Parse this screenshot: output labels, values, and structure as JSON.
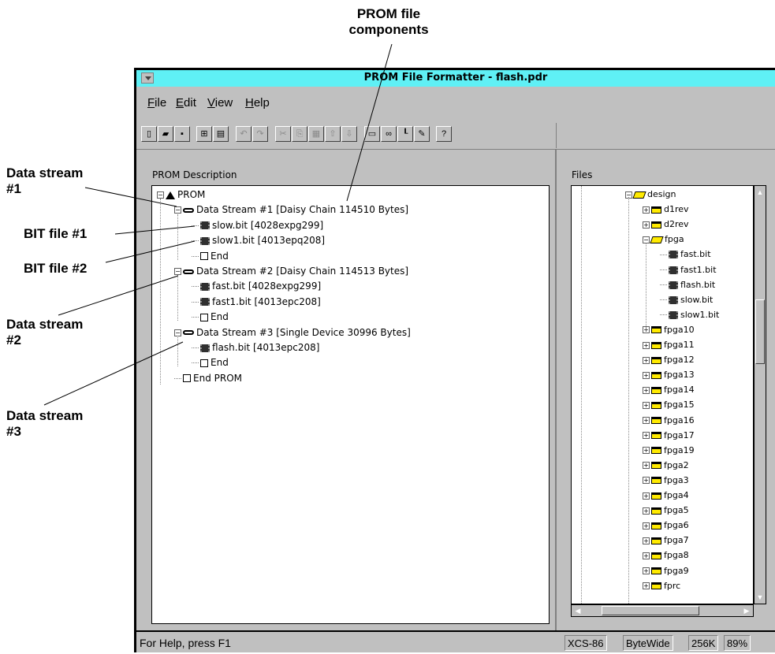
{
  "annotations": {
    "prom_components": [
      "PROM file",
      "components"
    ],
    "data_stream_1": [
      "Data stream",
      "#1"
    ],
    "bit_file_1": "BIT file #1",
    "bit_file_2": "BIT file #2",
    "data_stream_2": [
      "Data stream",
      "#2"
    ],
    "data_stream_3": [
      "Data stream",
      "#3"
    ]
  },
  "window": {
    "title": "PROM File Formatter - flash.pdr",
    "menu": [
      "File",
      "Edit",
      "View",
      "Help"
    ],
    "menu_mnemonics": [
      "F",
      "E",
      "V",
      "H"
    ]
  },
  "toolbar": {
    "buttons": [
      "new-icon",
      "open-icon",
      "save-icon",
      "copy-format-icon",
      "properties-icon",
      "undo-icon",
      "redo-icon",
      "cut-icon",
      "copy-icon",
      "paste-icon",
      "move-up-icon",
      "move-down-icon",
      "add-prom-icon",
      "add-stream-icon",
      "tree-icon",
      "wand-icon",
      "context-help-icon"
    ],
    "glyphs": [
      "▯",
      "▰",
      "▪",
      "⊞",
      "▤",
      "↶",
      "↷",
      "✂",
      "⎘",
      "▦",
      "⇧",
      "⇩",
      "▭",
      "∞",
      "┖",
      "✎",
      "?"
    ],
    "disabled": [
      false,
      false,
      false,
      false,
      false,
      true,
      true,
      true,
      true,
      true,
      true,
      true,
      false,
      false,
      false,
      false,
      false
    ]
  },
  "left_panel": {
    "label": "PROM Description",
    "tree": [
      {
        "text": "PROM",
        "icon": "prom",
        "level": 0,
        "expander": "-"
      },
      {
        "text": "Data Stream #1 [Daisy Chain 114510 Bytes]",
        "icon": "link",
        "level": 1,
        "expander": "-"
      },
      {
        "text": "slow.bit   [4028expg299]",
        "icon": "chip",
        "level": 2
      },
      {
        "text": "slow1.bit   [4013epq208]",
        "icon": "chip",
        "level": 2
      },
      {
        "text": "End",
        "icon": "box",
        "level": 2
      },
      {
        "text": "Data Stream #2 [Daisy Chain 114513 Bytes]",
        "icon": "link",
        "level": 1,
        "expander": "-"
      },
      {
        "text": "fast.bit   [4028expg299]",
        "icon": "chip",
        "level": 2
      },
      {
        "text": "fast1.bit   [4013epc208]",
        "icon": "chip",
        "level": 2
      },
      {
        "text": "End",
        "icon": "box",
        "level": 2
      },
      {
        "text": "Data Stream #3 [Single Device 30996 Bytes]",
        "icon": "link",
        "level": 1,
        "expander": "-"
      },
      {
        "text": "flash.bit   [4013epc208]",
        "icon": "chip",
        "level": 2
      },
      {
        "text": "End",
        "icon": "box",
        "level": 2
      },
      {
        "text": "End PROM",
        "icon": "box",
        "level": 1
      }
    ]
  },
  "right_panel": {
    "label": "Files",
    "tree": [
      {
        "text": "design",
        "icon": "folder-open",
        "level": 0,
        "expander": "-"
      },
      {
        "text": "d1rev",
        "icon": "folder",
        "level": 1,
        "expander": "+"
      },
      {
        "text": "d2rev",
        "icon": "folder",
        "level": 1,
        "expander": "+"
      },
      {
        "text": "fpga",
        "icon": "folder-open",
        "level": 1,
        "expander": "-"
      },
      {
        "text": "fast.bit",
        "icon": "chip",
        "level": 2
      },
      {
        "text": "fast1.bit",
        "icon": "chip",
        "level": 2
      },
      {
        "text": "flash.bit",
        "icon": "chip",
        "level": 2
      },
      {
        "text": "slow.bit",
        "icon": "chip",
        "level": 2
      },
      {
        "text": "slow1.bit",
        "icon": "chip",
        "level": 2
      },
      {
        "text": "fpga10",
        "icon": "folder",
        "level": 1,
        "expander": "+"
      },
      {
        "text": "fpga11",
        "icon": "folder",
        "level": 1,
        "expander": "+"
      },
      {
        "text": "fpga12",
        "icon": "folder",
        "level": 1,
        "expander": "+"
      },
      {
        "text": "fpga13",
        "icon": "folder",
        "level": 1,
        "expander": "+"
      },
      {
        "text": "fpga14",
        "icon": "folder",
        "level": 1,
        "expander": "+"
      },
      {
        "text": "fpga15",
        "icon": "folder",
        "level": 1,
        "expander": "+"
      },
      {
        "text": "fpga16",
        "icon": "folder",
        "level": 1,
        "expander": "+"
      },
      {
        "text": "fpga17",
        "icon": "folder",
        "level": 1,
        "expander": "+"
      },
      {
        "text": "fpga19",
        "icon": "folder",
        "level": 1,
        "expander": "+"
      },
      {
        "text": "fpga2",
        "icon": "folder",
        "level": 1,
        "expander": "+"
      },
      {
        "text": "fpga3",
        "icon": "folder",
        "level": 1,
        "expander": "+"
      },
      {
        "text": "fpga4",
        "icon": "folder",
        "level": 1,
        "expander": "+"
      },
      {
        "text": "fpga5",
        "icon": "folder",
        "level": 1,
        "expander": "+"
      },
      {
        "text": "fpga6",
        "icon": "folder",
        "level": 1,
        "expander": "+"
      },
      {
        "text": "fpga7",
        "icon": "folder",
        "level": 1,
        "expander": "+"
      },
      {
        "text": "fpga8",
        "icon": "folder",
        "level": 1,
        "expander": "+"
      },
      {
        "text": "fpga9",
        "icon": "folder",
        "level": 1,
        "expander": "+"
      },
      {
        "text": "fprc",
        "icon": "folder",
        "level": 1,
        "expander": "+"
      }
    ]
  },
  "status": {
    "help": "For Help, press F1",
    "fields": [
      "XCS-86",
      "ByteWide",
      "256K",
      "89%"
    ]
  },
  "colors": {
    "titlebar": "#5ff0f5",
    "chrome": "#c0c0c0",
    "folder": "#ffea00"
  }
}
